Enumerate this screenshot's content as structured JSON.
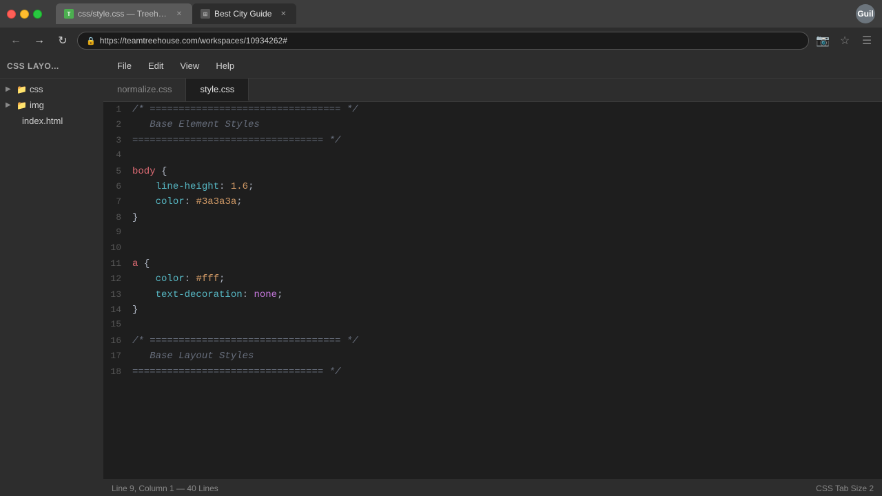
{
  "titlebar": {
    "tab1_label": "css/style.css — Treehouse",
    "tab2_label": "Best City Guide",
    "user_label": "Guil"
  },
  "addressbar": {
    "url": "https://teamtreehouse.com/workspaces/10934262#"
  },
  "menubar": {
    "items": [
      "File",
      "Edit",
      "View",
      "Help"
    ]
  },
  "left_panel": {
    "title": "CSS Layo...",
    "tree": [
      {
        "id": "css-folder",
        "label": "css",
        "type": "folder",
        "indent": 0
      },
      {
        "id": "img-folder",
        "label": "img",
        "type": "folder",
        "indent": 0
      },
      {
        "id": "index-file",
        "label": "index.html",
        "type": "file",
        "indent": 0
      }
    ]
  },
  "file_tabs": [
    {
      "id": "normalize",
      "label": "normalize.css",
      "active": false
    },
    {
      "id": "style",
      "label": "style.css",
      "active": true
    }
  ],
  "code_lines": [
    {
      "num": "1",
      "content": "comment_start"
    },
    {
      "num": "2",
      "content": "   Base Element Styles"
    },
    {
      "num": "3",
      "content": "comment_end"
    },
    {
      "num": "4",
      "content": ""
    },
    {
      "num": "5",
      "content": "body_selector"
    },
    {
      "num": "6",
      "content": "   line_height"
    },
    {
      "num": "7",
      "content": "   color_3a"
    },
    {
      "num": "8",
      "content": "close_brace"
    },
    {
      "num": "9",
      "content": ""
    },
    {
      "num": "10",
      "content": ""
    },
    {
      "num": "11",
      "content": "a_selector"
    },
    {
      "num": "12",
      "content": "   color_fff"
    },
    {
      "num": "13",
      "content": "   text_decoration"
    },
    {
      "num": "14",
      "content": "close_brace"
    },
    {
      "num": "15",
      "content": ""
    },
    {
      "num": "16",
      "content": "comment_start2"
    },
    {
      "num": "17",
      "content": "   Base Layout Styles"
    },
    {
      "num": "18",
      "content": "comment_end2"
    }
  ],
  "status_bar": {
    "left": "Line 9, Column 1 — 40 Lines",
    "right": "CSS    Tab Size  2"
  }
}
